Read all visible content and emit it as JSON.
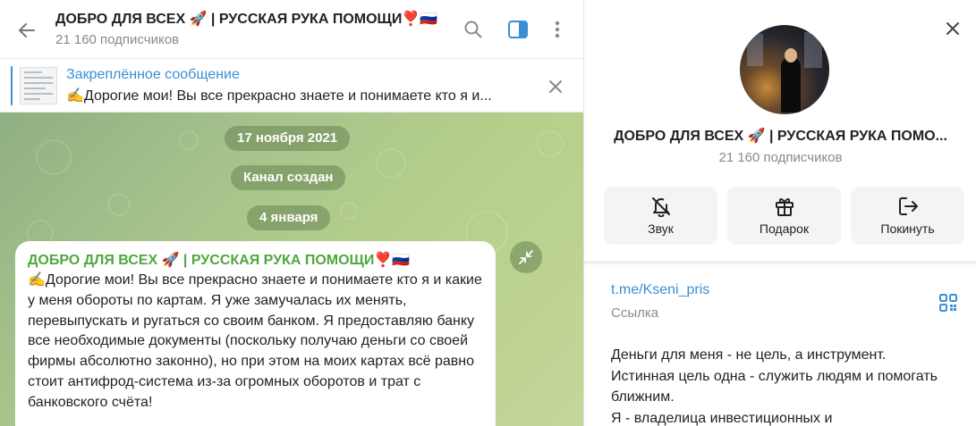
{
  "chat": {
    "title": "ДОБРО ДЛЯ ВСЕХ 🚀 | РУССКАЯ РУКА ПОМОЩИ❣️🇷🇺",
    "subscribers": "21 160 подписчиков",
    "pinned_title": "Закреплённое сообщение",
    "pinned_text": "✍️Дорогие мои! Вы все прекрасно знаете и понимаете кто я и...",
    "dates": [
      "17 ноября 2021",
      "Канал создан",
      "4 января"
    ],
    "message": {
      "author": "ДОБРО ДЛЯ ВСЕХ 🚀 | РУССКАЯ РУКА ПОМОЩИ❣️🇷🇺",
      "text": "✍️Дорогие мои! Вы все прекрасно знаете и понимаете кто я и какие у меня обороты по картам. Я уже замучалась их менять, перевыпускать и ругаться со своим банком. Я предоставляю банку все необходимые документы (поскольку получаю деньги со своей фирмы абсолютно законно), но при этом на моих картах всё равно стоит антифрод-система из-за огромных оборотов и трат с банковского счёта!"
    }
  },
  "info": {
    "title": "ДОБРО ДЛЯ ВСЕХ 🚀 | РУССКАЯ РУКА ПОМО...",
    "subscribers": "21 160 подписчиков",
    "actions": [
      {
        "label": "Звук",
        "icon": "bell-off-icon"
      },
      {
        "label": "Подарок",
        "icon": "gift-icon"
      },
      {
        "label": "Покинуть",
        "icon": "leave-icon"
      }
    ],
    "link": "t.me/Kseni_pris",
    "link_caption": "Ссылка",
    "description": [
      "Деньги для меня - не цель, а инструмент.",
      "Истинная цель одна - служить людям и помогать",
      "ближним.",
      "Я - владелица инвестиционных и"
    ]
  },
  "colors": {
    "accent": "#3a8fd4",
    "author": "#4fa83d",
    "pill": "#708c58"
  }
}
